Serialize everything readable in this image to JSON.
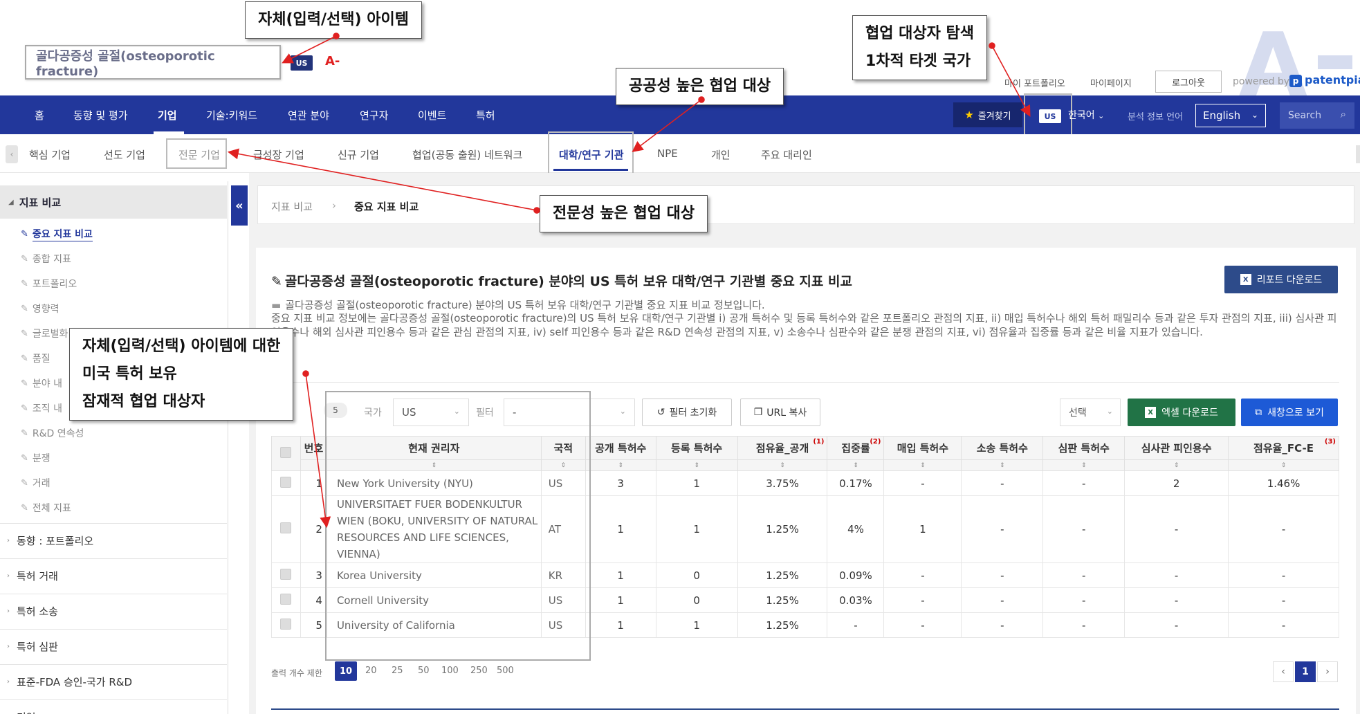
{
  "search": {
    "query": "골다공증성 골절(osteoporotic fracture)",
    "country_badge": "US",
    "font_toggle": "A-"
  },
  "top_links": {
    "portfolio": "마이 포트폴리오",
    "mypage": "마이페이지",
    "logout": "로그아웃",
    "powered_by": "powered by",
    "logo_mark": "p",
    "logo_text": "patentpia",
    "big_letter": "A"
  },
  "nav": {
    "items": [
      "홈",
      "동향 및 평가",
      "기업",
      "기술:키워드",
      "연관 분야",
      "연구자",
      "이벤트",
      "특허"
    ],
    "favorites": "즐겨찾기",
    "country_badge": "US",
    "language_ko": "한국어",
    "analysis_language_label": "분석 정보 언어",
    "analysis_language_value": "English",
    "search_placeholder": "Search"
  },
  "subnav": {
    "items": [
      "핵심 기업",
      "선도 기업",
      "전문 기업",
      "급성장 기업",
      "신규 기업",
      "협업(공동 출원) 네트워크",
      "대학/연구 기관",
      "NPE",
      "개인",
      "주요 대리인"
    ]
  },
  "sidebar": {
    "section": "지표 비교",
    "items": [
      "중요 지표 비교",
      "종합 지표",
      "포트폴리오",
      "영향력",
      "글로벌화",
      "품질",
      "분야 내",
      "조직 내",
      "R&D 연속성",
      "분쟁",
      "거래",
      "전체 지표"
    ],
    "groups": [
      "동향 : 포트폴리오",
      "특허 거래",
      "특허 소송",
      "특허 심판",
      "표준-FDA 승인-국가 R&D",
      "기업"
    ]
  },
  "breadcrumb": {
    "parent": "지표 비교",
    "sep": "›",
    "current": "중요 지표 비교"
  },
  "panel": {
    "title": "골다공증성 골절(osteoporotic fracture) 분야의 US 특허 보유 대학/연구 기관별 중요 지표 비교",
    "report_button": "리포트 다운로드",
    "desc_line1": "골다공증성 골절(osteoporotic fracture) 분야의 US 특허 보유 대학/연구 기관별 중요 지표 비교 정보입니다.",
    "desc_line2": "중요 지표 비교 정보에는 골다공증성 골절(osteoporotic fracture)의 US 특허 보유 대학/연구 기관별 i) 공개 특허수 및 등록 특허수와 같은 포트폴리오 관점의 지표, ii) 매입 특허수나 해외 특허 패밀리수 등과 같은 투자 관점의 지표, iii) 심사관 피인용수나 해외 심사관 피인용수 등과 같은 관심 관점의 지표, iv) self 피인용수 등과 같은 R&D 연속성 관점의 지표, v) 소송수나 심판수와 같은 분쟁 관점의 지표, vi) 점유율과 집중률 등과 같은 비율 지표가 있습니다."
  },
  "filters": {
    "count": "5",
    "country_label": "국가",
    "country_value": "US",
    "filter_label": "필터",
    "filter_value": "-",
    "reset_button": "필터 초기화",
    "copy_url_button": "URL 복사",
    "choose_value": "선택",
    "excel_button": "엑셀 다운로드",
    "newwin_button": "새창으로 보기"
  },
  "table": {
    "headers": [
      "번호",
      "현재 권리자",
      "국적",
      "공개 특허수",
      "등록 특허수",
      "점유율_공개",
      "집중률",
      "매입 특허수",
      "소송 특허수",
      "심판 특허수",
      "심사관 피인용수",
      "점유율_FC-E"
    ],
    "footnotes": {
      "share_public": "(1)",
      "concentration": "(2)",
      "share_fce": "(3)"
    },
    "rows": [
      [
        "1",
        "New York University (NYU)",
        "US",
        "3",
        "1",
        "3.75%",
        "0.17%",
        "-",
        "-",
        "-",
        "2",
        "1.46%"
      ],
      [
        "2",
        "UNIVERSITAET FUER BODENKULTUR WIEN (BOKU, UNIVERSITY OF NATURAL RESOURCES AND LIFE SCIENCES, VIENNA)",
        "AT",
        "1",
        "1",
        "1.25%",
        "4%",
        "1",
        "-",
        "-",
        "-",
        "-"
      ],
      [
        "3",
        "Korea University",
        "KR",
        "1",
        "0",
        "1.25%",
        "0.09%",
        "-",
        "-",
        "-",
        "-",
        "-"
      ],
      [
        "4",
        "Cornell University",
        "US",
        "1",
        "0",
        "1.25%",
        "0.03%",
        "-",
        "-",
        "-",
        "-",
        "-"
      ],
      [
        "5",
        "University of California",
        "US",
        "1",
        "1",
        "1.25%",
        "-",
        "-",
        "-",
        "-",
        "-",
        "-"
      ]
    ]
  },
  "pagination": {
    "limit_label": "출력 개수 제한",
    "limits": [
      "10",
      "20",
      "25",
      "50",
      "100",
      "250",
      "500"
    ],
    "current_page": "1",
    "prev": "‹",
    "next": "›"
  },
  "annotations": {
    "own_item": "자체(입력/선택) 아이템",
    "collab_explore_1": "협업 대상자 탐색",
    "collab_explore_2": "1차적 타겟 국가",
    "public_collab": "공공성 높은 협업 대상",
    "expert_collab": "전문성 높은 협업 대상",
    "potential_1": "자체(입력/선택) 아이템에 대한",
    "potential_2": "미국 특허 보유",
    "potential_3": "잠재적 협업 대상자"
  },
  "colors": {
    "nav_blue": "#22379b",
    "annotation_red": "#e02020",
    "excel_green": "#217346",
    "newwin_blue": "#1d5ad6"
  }
}
